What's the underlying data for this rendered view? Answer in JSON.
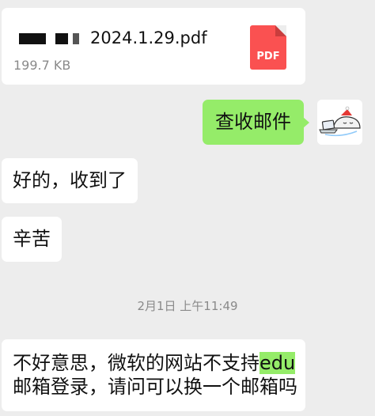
{
  "file_message": {
    "file_name": "2024.1.29.pdf",
    "file_size": "199.7 KB",
    "file_type_label": "PDF",
    "name_redacted": true
  },
  "outgoing_message": {
    "text": "查收邮件"
  },
  "avatar": {
    "icon": "sleeping-seal-with-laptop-sticker-icon"
  },
  "incoming_messages": [
    {
      "text": "好的，收到了"
    },
    {
      "text": "辛苦"
    }
  ],
  "timestamp": "2月1日 上午11:49",
  "last_message": {
    "before_highlight": "不好意思，微软的网站不支持",
    "highlight": "edu",
    "line2": "邮箱登录，请问可以换一个邮箱吗"
  },
  "colors": {
    "background": "#ededed",
    "outgoing_bubble": "#95ec69",
    "incoming_bubble": "#ffffff",
    "pdf_icon": "#fa5151",
    "secondary_text": "#8a8a8a"
  }
}
